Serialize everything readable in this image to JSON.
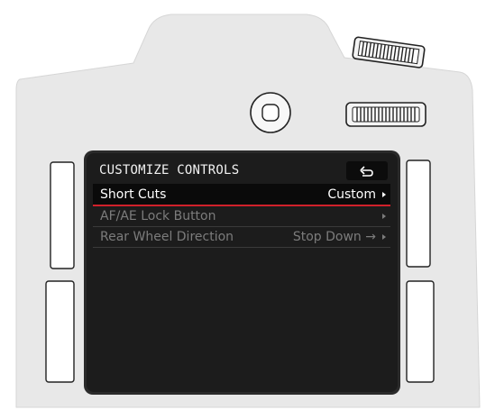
{
  "screen": {
    "title": "CUSTOMIZE CONTROLS",
    "back_icon": "back-arrow-icon",
    "menu_items": [
      {
        "label": "Short Cuts",
        "value": "Custom",
        "selected": true
      },
      {
        "label": "AF/AE Lock Button",
        "value": "",
        "selected": false
      },
      {
        "label": "Rear Wheel Direction",
        "value": "Stop Down →",
        "selected": false
      }
    ]
  },
  "colors": {
    "camera_body": "#e8e8e8",
    "screen_background": "#1c1c1c",
    "selection_underline": "#d0202a",
    "inactive_text": "#7c7c7c",
    "active_text": "#ffffff"
  }
}
